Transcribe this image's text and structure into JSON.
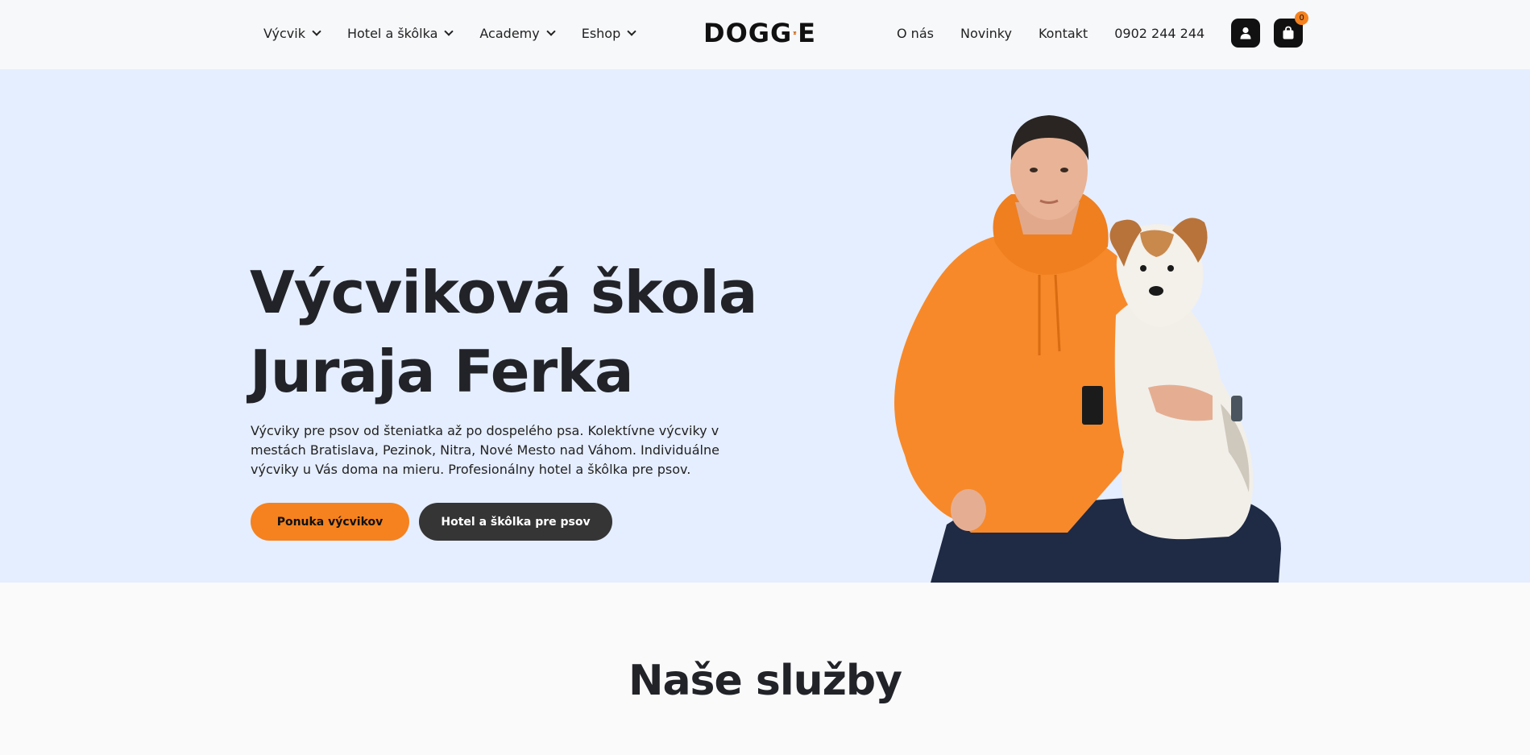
{
  "header": {
    "nav_left": [
      {
        "label": "Výcvik"
      },
      {
        "label": "Hotel a škôlka"
      },
      {
        "label": "Academy"
      },
      {
        "label": "Eshop"
      }
    ],
    "logo": {
      "text_left": "DOGG",
      "text_right": "E"
    },
    "nav_right": [
      {
        "label": "O nás"
      },
      {
        "label": "Novinky"
      },
      {
        "label": "Kontakt"
      }
    ],
    "phone": "0902 244 244",
    "cart_count": "0"
  },
  "hero": {
    "title": "Výcviková škola Juraja Ferka",
    "description": "Výcviky pre psov od šteniatka až po dospelého psa. Kolektívne výcviky v mestách Bratislava, Pezinok, Nitra, Nové Mesto nad Váhom. Individuálne výcviky u Vás doma na mieru. Profesionálny hotel a škôlka pre psov.",
    "primary_button": "Ponuka výcvikov",
    "secondary_button": "Hotel a škôlka pre psov"
  },
  "services": {
    "title": "Naše služby"
  },
  "colors": {
    "accent": "#f5821f",
    "hero_bg": "#e5eeff",
    "dark_button": "#353535"
  }
}
